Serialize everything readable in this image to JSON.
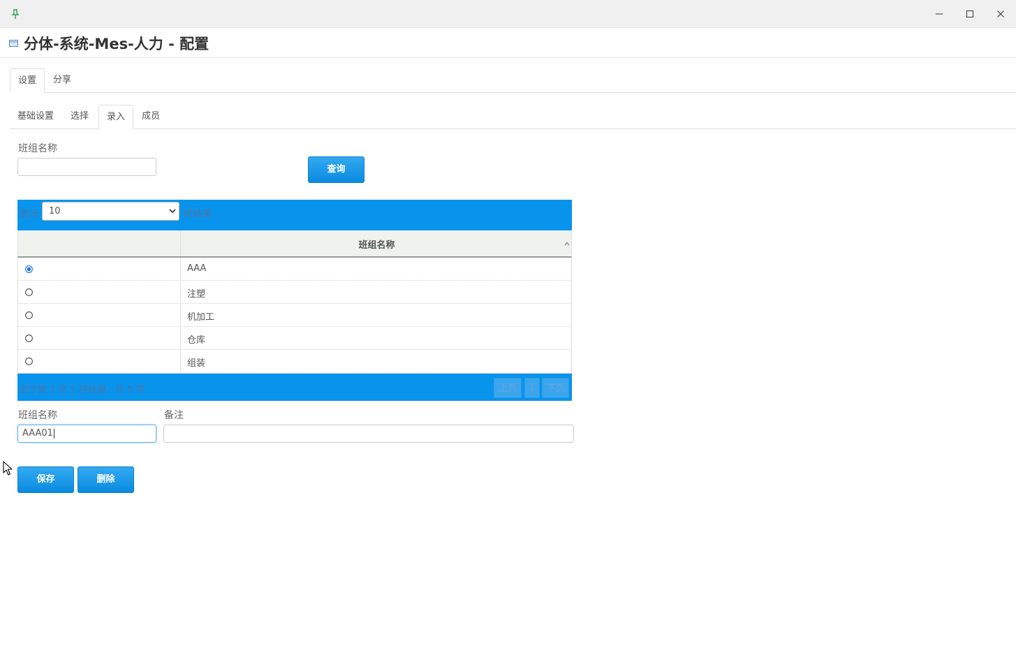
{
  "window": {
    "title": "分体-系统-Mes-人力 - 配置",
    "pin_icon": "pin-icon",
    "controls": [
      "minimize-icon",
      "maximize-icon",
      "close-icon"
    ]
  },
  "tabs_main": [
    {
      "label": "设置",
      "active": true
    },
    {
      "label": "分享",
      "active": false
    }
  ],
  "tabs_sub": [
    {
      "label": "基础设置",
      "active": false
    },
    {
      "label": "选择",
      "active": false
    },
    {
      "label": "录入",
      "active": true
    },
    {
      "label": "成员",
      "active": false
    }
  ],
  "search": {
    "label": "班组名称",
    "value": "",
    "button": "查询"
  },
  "table": {
    "length_prefix": "显示",
    "length_value": "10",
    "length_suffix": "项结果",
    "column_header": "班组名称",
    "rows": [
      {
        "name": "AAA",
        "selected": true
      },
      {
        "name": "注塑",
        "selected": false
      },
      {
        "name": "机加工",
        "selected": false
      },
      {
        "name": "仓库",
        "selected": false
      },
      {
        "name": "组装",
        "selected": false
      }
    ],
    "info": "显示第 1 至 5 项结果，共 5 项",
    "prev": "上页",
    "page": "1",
    "next": "下页"
  },
  "form": {
    "name_label": "班组名称",
    "name_value": "AAA01",
    "remark_label": "备注",
    "remark_value": "",
    "save": "保存",
    "delete": "删除"
  },
  "colors": {
    "accent": "#0894ec",
    "button": "#1a98e6"
  }
}
